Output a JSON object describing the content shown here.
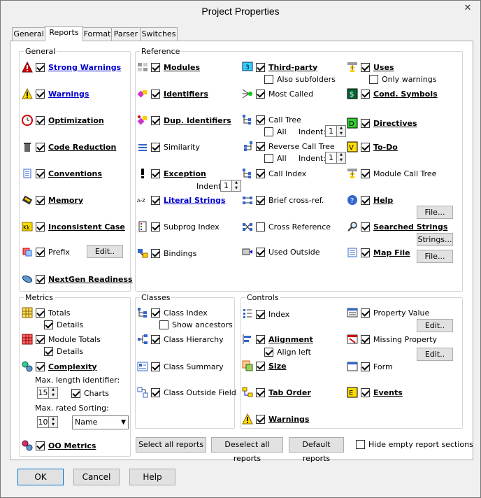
{
  "window": {
    "title": "Project Properties",
    "close": "✕"
  },
  "tabs": [
    "General",
    "Reports",
    "Format",
    "Parser",
    "Switches"
  ],
  "groups": {
    "general": "General",
    "reference": "Reference",
    "metrics": "Metrics",
    "classes": "Classes",
    "controls": "Controls"
  },
  "general_items": [
    {
      "label": "Strong Warnings",
      "icon": "warning-red-icon"
    },
    {
      "label": "Warnings",
      "icon": "warning-yellow-icon"
    },
    {
      "label": "Optimization",
      "icon": "clock-icon"
    },
    {
      "label": "Code Reduction",
      "icon": "trash-icon"
    },
    {
      "label": "Conventions",
      "icon": "conventions-icon"
    },
    {
      "label": "Memory",
      "icon": "memory-icon"
    },
    {
      "label": "Inconsistent Case",
      "icon": "case-icon"
    },
    {
      "label": "Prefix",
      "icon": "prefix-icon"
    },
    {
      "label": "NextGen Readiness",
      "icon": "nextgen-icon"
    }
  ],
  "prefix_edit": "Edit..",
  "reference_col1": [
    {
      "label": "Modules"
    },
    {
      "label": "Identifiers"
    },
    {
      "label": "Dup. Identifiers"
    },
    {
      "label": "Similarity"
    },
    {
      "label": "Exception"
    },
    {
      "label": "Literal Strings"
    },
    {
      "label": "Subprog Index"
    },
    {
      "label": "Bindings"
    }
  ],
  "indent_label": "Indent:",
  "indent_value": "1",
  "reference_col2": {
    "third_party": "Third-party",
    "also_subfolders": "Also subfolders",
    "most_called": "Most Called",
    "call_tree": "Call Tree",
    "all": "All",
    "reverse_call_tree": "Reverse Call Tree",
    "call_index": "Call Index",
    "brief_cross_ref": "Brief cross-ref.",
    "cross_reference": "Cross Reference",
    "used_outside": "Used Outside"
  },
  "reference_col3": {
    "uses": "Uses",
    "only_warnings": "Only warnings",
    "cond_symbols": "Cond. Symbols",
    "directives": "Directives",
    "to_do": "To-Do",
    "module_call_tree": "Module Call Tree",
    "help": "Help",
    "file_btn": "File...",
    "searched_strings": "Searched Strings",
    "strings_btn": "Strings...",
    "map_file": "Map File"
  },
  "metrics": {
    "totals": "Totals",
    "details": "Details",
    "module_totals": "Module Totals",
    "complexity": "Complexity",
    "max_length_label": "Max. length identifier:",
    "max_length_value": "15",
    "charts": "Charts",
    "max_rated_label": "Max. rated Sorting:",
    "max_rated_value": "10",
    "sorting_value": "Name",
    "oo_metrics": "OO Metrics"
  },
  "classes": {
    "class_index": "Class Index",
    "show_ancestors": "Show ancestors",
    "class_hierarchy": "Class Hierarchy",
    "class_summary": "Class Summary",
    "class_outside_field": "Class Outside Field"
  },
  "controls": {
    "index": "Index",
    "alignment": "Alignment",
    "align_left": "Align left",
    "size": "Size",
    "tab_order": "Tab Order",
    "warnings": "Warnings",
    "property_value": "Property Value",
    "missing_property": "Missing Property",
    "form": "Form",
    "events": "Events",
    "edit_btn": "Edit.."
  },
  "report_buttons": {
    "select_all": "Select all reports",
    "deselect_all": "Deselect all reports",
    "default": "Default reports",
    "hide_empty": "Hide empty report sections"
  },
  "dialog_buttons": {
    "ok": "OK",
    "cancel": "Cancel",
    "help": "Help"
  }
}
